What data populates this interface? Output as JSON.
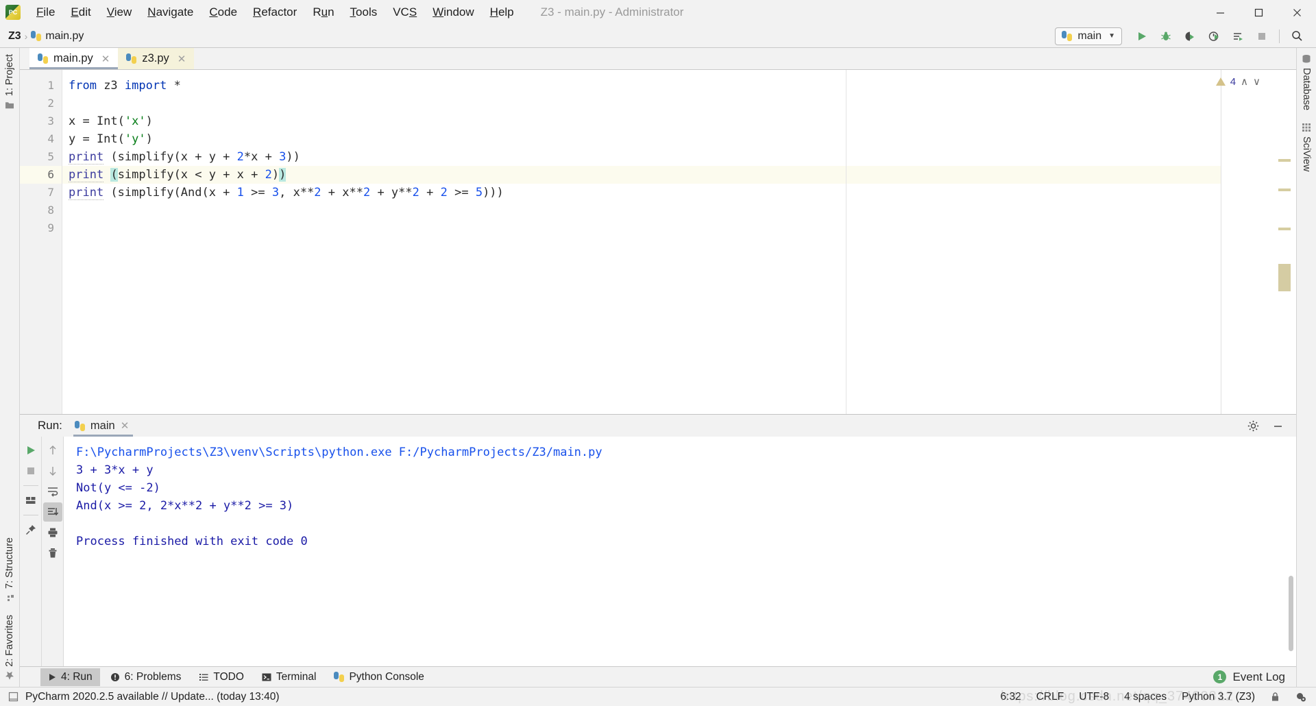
{
  "window": {
    "title": "Z3 - main.py - Administrator",
    "logo_icon": "pycharm-logo-icon",
    "controls": [
      {
        "name": "minimize-button",
        "glyph": "─"
      },
      {
        "name": "maximize-button",
        "glyph": "❐"
      },
      {
        "name": "close-button",
        "glyph": "✕"
      }
    ]
  },
  "menubar": {
    "items": [
      {
        "label": "File",
        "mnemonic": "F"
      },
      {
        "label": "Edit",
        "mnemonic": "E"
      },
      {
        "label": "View",
        "mnemonic": "V"
      },
      {
        "label": "Navigate",
        "mnemonic": "N"
      },
      {
        "label": "Code",
        "mnemonic": "C"
      },
      {
        "label": "Refactor",
        "mnemonic": "R"
      },
      {
        "label": "Run",
        "mnemonic": "u"
      },
      {
        "label": "Tools",
        "mnemonic": "T"
      },
      {
        "label": "VCS",
        "mnemonic": "S"
      },
      {
        "label": "Window",
        "mnemonic": "W"
      },
      {
        "label": "Help",
        "mnemonic": "H"
      }
    ]
  },
  "navbar": {
    "breadcrumb": {
      "project": "Z3",
      "separator": "›",
      "file": "main.py"
    },
    "run_config": {
      "name": "main",
      "caret": "▼",
      "icon": "python-file-icon"
    },
    "buttons": [
      {
        "name": "run-button",
        "title": "Run"
      },
      {
        "name": "debug-button",
        "title": "Debug"
      },
      {
        "name": "run-with-coverage-button",
        "title": "Run with Coverage"
      },
      {
        "name": "profile-button",
        "title": "Profile"
      },
      {
        "name": "more-run-options-button",
        "title": "More Run/Debug"
      },
      {
        "name": "stop-button",
        "title": "Stop"
      },
      {
        "name": "search-everywhere-button",
        "title": "Search Everywhere"
      }
    ]
  },
  "left_strip": {
    "top": [
      {
        "label": "1: Project",
        "mnemonic": "1",
        "icon": "project-folder-icon"
      }
    ],
    "bottom": [
      {
        "label": "7: Structure",
        "mnemonic": "7",
        "icon": "structure-icon"
      },
      {
        "label": "2: Favorites",
        "mnemonic": "2",
        "icon": "star-icon"
      }
    ]
  },
  "right_strip": {
    "items": [
      {
        "label": "Database",
        "icon": "database-icon"
      },
      {
        "label": "SciView",
        "icon": "sciview-grid-icon"
      }
    ]
  },
  "editor": {
    "tabs": [
      {
        "label": "main.py",
        "icon": "python-file-icon",
        "state": "active",
        "close": "✕"
      },
      {
        "label": "z3.py",
        "icon": "python-file-icon",
        "state": "modified",
        "close": "✕"
      }
    ],
    "inspection": {
      "warning_count": "4",
      "icon": "warning-triangle-icon",
      "prev": "∧",
      "next": "∨"
    },
    "current_line": 6,
    "lines": [
      {
        "n": "1",
        "tokens": [
          {
            "t": "from",
            "c": "k-kw"
          },
          {
            "t": " z3 ",
            "c": "k-def"
          },
          {
            "t": "import",
            "c": "k-kw"
          },
          {
            "t": " *",
            "c": "k-def"
          }
        ]
      },
      {
        "n": "2",
        "tokens": []
      },
      {
        "n": "3",
        "tokens": [
          {
            "t": "x = Int(",
            "c": "k-def"
          },
          {
            "t": "'x'",
            "c": "k-str"
          },
          {
            "t": ")",
            "c": "k-def"
          }
        ]
      },
      {
        "n": "4",
        "tokens": [
          {
            "t": "y = Int(",
            "c": "k-def"
          },
          {
            "t": "'y'",
            "c": "k-str"
          },
          {
            "t": ")",
            "c": "k-def"
          }
        ]
      },
      {
        "n": "5",
        "tokens": [
          {
            "t": "print",
            "c": "k-print"
          },
          {
            "t": " (simplify(x + y + ",
            "c": "k-def"
          },
          {
            "t": "2",
            "c": "k-num"
          },
          {
            "t": "*x + ",
            "c": "k-def"
          },
          {
            "t": "3",
            "c": "k-num"
          },
          {
            "t": "))",
            "c": "k-def"
          }
        ]
      },
      {
        "n": "6",
        "tokens": [
          {
            "t": "print",
            "c": "k-print"
          },
          {
            "t": " ",
            "c": "k-def"
          },
          {
            "t": "(",
            "c": "k-def brk"
          },
          {
            "t": "simplify(x < y + x + ",
            "c": "k-def"
          },
          {
            "t": "2",
            "c": "k-num"
          },
          {
            "t": ")",
            "c": "k-def"
          },
          {
            "t": ")",
            "c": "k-def brk"
          }
        ]
      },
      {
        "n": "7",
        "tokens": [
          {
            "t": "print",
            "c": "k-print"
          },
          {
            "t": " (simplify(And(x + ",
            "c": "k-def"
          },
          {
            "t": "1",
            "c": "k-num"
          },
          {
            "t": " >= ",
            "c": "k-def"
          },
          {
            "t": "3",
            "c": "k-num"
          },
          {
            "t": ", x**",
            "c": "k-def"
          },
          {
            "t": "2",
            "c": "k-num"
          },
          {
            "t": " + x**",
            "c": "k-def"
          },
          {
            "t": "2",
            "c": "k-num"
          },
          {
            "t": " + y**",
            "c": "k-def"
          },
          {
            "t": "2",
            "c": "k-num"
          },
          {
            "t": " + ",
            "c": "k-def"
          },
          {
            "t": "2",
            "c": "k-num"
          },
          {
            "t": " >= ",
            "c": "k-def"
          },
          {
            "t": "5",
            "c": "k-num"
          },
          {
            "t": ")))",
            "c": "k-def"
          }
        ]
      },
      {
        "n": "8",
        "tokens": []
      },
      {
        "n": "9",
        "tokens": []
      }
    ]
  },
  "run_panel": {
    "label": "Run:",
    "tab": {
      "label": "main",
      "icon": "python-file-icon",
      "close": "✕"
    },
    "header_buttons": [
      {
        "name": "settings-gear-button",
        "icon": "gear-icon"
      },
      {
        "name": "hide-panel-button",
        "icon": "minimize-icon"
      }
    ],
    "tools_left": [
      {
        "name": "rerun-button",
        "icon": "play-icon"
      },
      {
        "name": "stop-process-button",
        "icon": "stop-square-icon"
      },
      {
        "name": "layout-button",
        "icon": "layout-icon"
      },
      {
        "name": "pin-tab-button",
        "icon": "pin-icon"
      }
    ],
    "tools_right": [
      {
        "name": "up-the-stack-button",
        "icon": "arrow-up-icon"
      },
      {
        "name": "down-the-stack-button",
        "icon": "arrow-down-icon"
      },
      {
        "name": "soft-wrap-button",
        "icon": "soft-wrap-icon"
      },
      {
        "name": "scroll-to-end-button",
        "icon": "scroll-to-end-icon",
        "active": true
      },
      {
        "name": "print-button",
        "icon": "printer-icon"
      },
      {
        "name": "clear-all-button",
        "icon": "trash-icon"
      }
    ],
    "console": [
      {
        "text": "F:\\PycharmProjects\\Z3\\venv\\Scripts\\python.exe F:/PycharmProjects/Z3/main.py",
        "kind": "cmd"
      },
      {
        "text": "3 + 3*x + y",
        "kind": "out"
      },
      {
        "text": "Not(y <= -2)",
        "kind": "out"
      },
      {
        "text": "And(x >= 2, 2*x**2 + y**2 >= 3)",
        "kind": "out"
      },
      {
        "text": "",
        "kind": "out"
      },
      {
        "text": "Process finished with exit code 0",
        "kind": "out"
      }
    ]
  },
  "bottom_bar": {
    "items": [
      {
        "label": "4: Run",
        "mnemonic": "4",
        "icon": "play-icon",
        "active": true
      },
      {
        "label": "6: Problems",
        "mnemonic": "6",
        "icon": "problems-icon",
        "active": false
      },
      {
        "label": "TODO",
        "mnemonic": "",
        "icon": "todo-list-icon",
        "active": false
      },
      {
        "label": "Terminal",
        "mnemonic": "",
        "icon": "terminal-icon",
        "active": false
      },
      {
        "label": "Python Console",
        "mnemonic": "",
        "icon": "python-console-icon",
        "active": false
      }
    ],
    "event_log": {
      "label": "Event Log",
      "count": "1"
    }
  },
  "statusbar": {
    "message": "PyCharm 2020.2.5 available // Update... (today 13:40)",
    "message_icon": "note-icon",
    "watermark": "https://blog.csdn.net/qq_37400312",
    "cells": [
      {
        "name": "caret-position",
        "value": "6:32"
      },
      {
        "name": "line-separator",
        "value": "CRLF"
      },
      {
        "name": "file-encoding",
        "value": "UTF-8"
      },
      {
        "name": "indent-size",
        "value": "4 spaces"
      },
      {
        "name": "python-interpreter",
        "value": "Python 3.7 (Z3)"
      }
    ],
    "icons": [
      {
        "name": "lock-icon"
      },
      {
        "name": "notifications-icon"
      }
    ]
  },
  "colors": {
    "accent_green": "#59a869",
    "keyword_blue": "#0033b3",
    "string_green": "#067d17",
    "number_blue": "#1750eb",
    "console_blue": "#1a1aa6",
    "tab_modified": "#f5f2db",
    "current_line": "#fcfbee"
  }
}
